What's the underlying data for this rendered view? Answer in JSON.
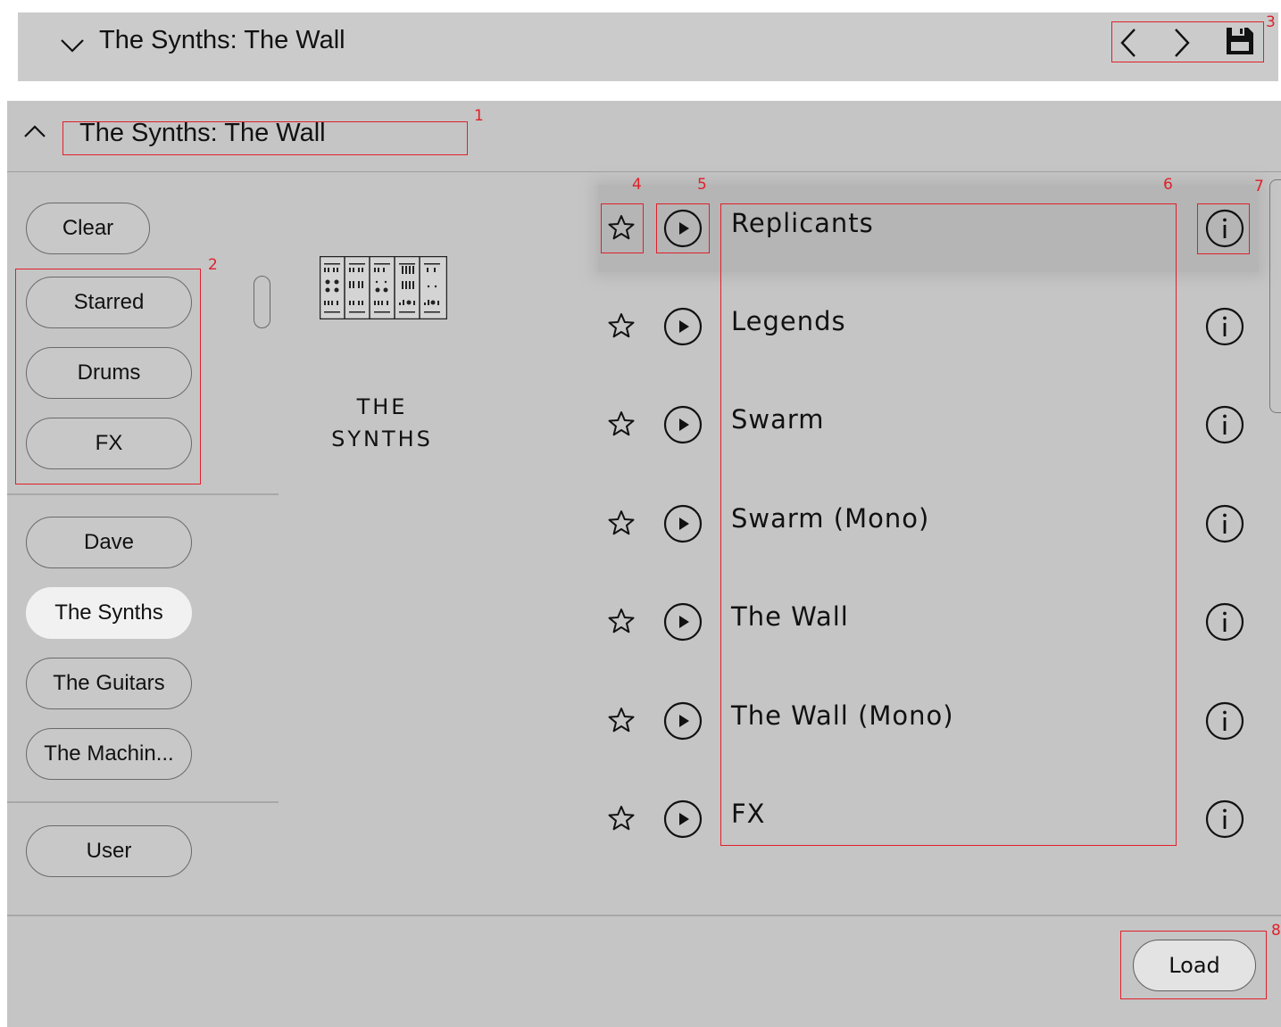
{
  "topbar": {
    "title": "The Synths: The Wall",
    "icons": [
      "chevron-down-icon",
      "chevron-left-icon",
      "chevron-right-icon",
      "save-icon"
    ]
  },
  "panel": {
    "title": "The Synths: The Wall",
    "collapse_icon": "chevron-up-icon"
  },
  "filters": {
    "clear_label": "Clear",
    "tags": [
      {
        "label": "Starred"
      },
      {
        "label": "Drums"
      },
      {
        "label": "FX"
      }
    ],
    "categories": [
      {
        "label": "Dave",
        "selected": false
      },
      {
        "label": "The Synths",
        "selected": true
      },
      {
        "label": "The Guitars",
        "selected": false
      },
      {
        "label": "The Machin...",
        "selected": false
      }
    ],
    "user_label": "User"
  },
  "brand": {
    "line1": "THE",
    "line2": "SYNTHS"
  },
  "presets": [
    {
      "name": "Replicants",
      "selected": true
    },
    {
      "name": "Legends",
      "selected": false
    },
    {
      "name": "Swarm",
      "selected": false
    },
    {
      "name": "Swarm (Mono)",
      "selected": false
    },
    {
      "name": "The Wall",
      "selected": false
    },
    {
      "name": "The Wall (Mono)",
      "selected": false
    },
    {
      "name": "FX",
      "selected": false
    }
  ],
  "footer": {
    "load_label": "Load"
  },
  "annotations": [
    "1",
    "2",
    "3",
    "4",
    "5",
    "6",
    "7",
    "8"
  ],
  "colors": {
    "panel_bg": "#c5c5c5",
    "topbar_bg": "#cbcbcb",
    "selected_pill": "#f1f1f1",
    "annotation": "#e0202a"
  }
}
